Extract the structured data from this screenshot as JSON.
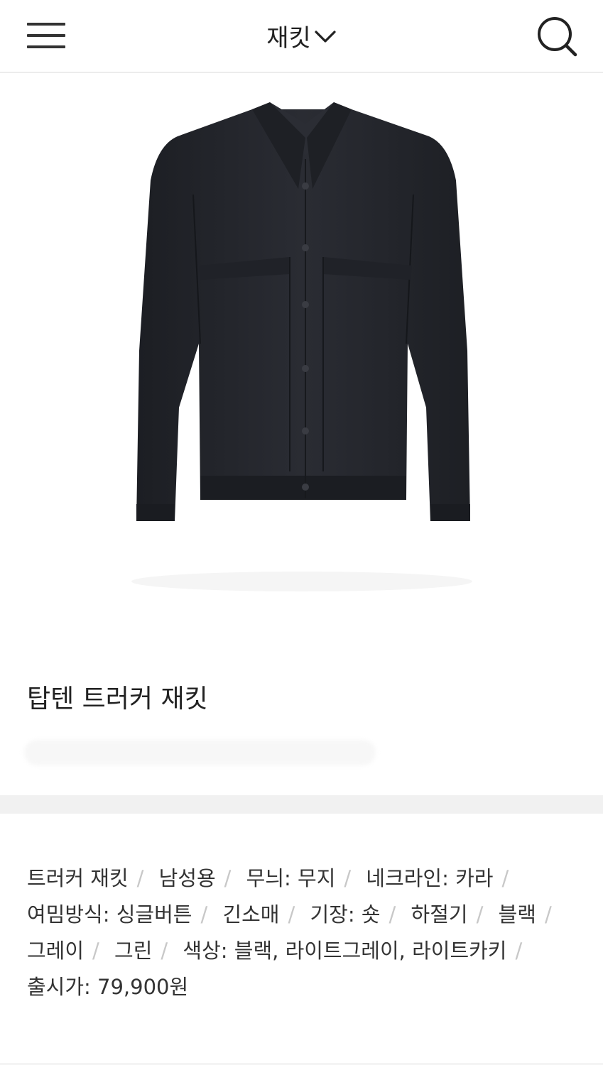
{
  "header": {
    "title": "재킷",
    "menu_icon": "hamburger-menu-icon",
    "dropdown_icon": "chevron-down-icon",
    "search_icon": "search-icon"
  },
  "product": {
    "image_icon": "jacket-image",
    "name": "탑텐 트러커 재킷"
  },
  "description": {
    "items": [
      "트러커 재킷",
      "남성용",
      "무늬: 무지",
      "네크라인: 카라",
      "여밈방식: 싱글버튼",
      "긴소매",
      "기장: 숏",
      "하절기",
      "블랙",
      "그레이",
      "그린",
      "색상: 블랙, 라이트그레이, 라이트카키",
      "출시가: 79,900원"
    ]
  },
  "colors": {
    "text": "#222222",
    "separator": "#c8c8c8",
    "section_gap": "#f1f1f1",
    "jacket": "#24262c"
  }
}
